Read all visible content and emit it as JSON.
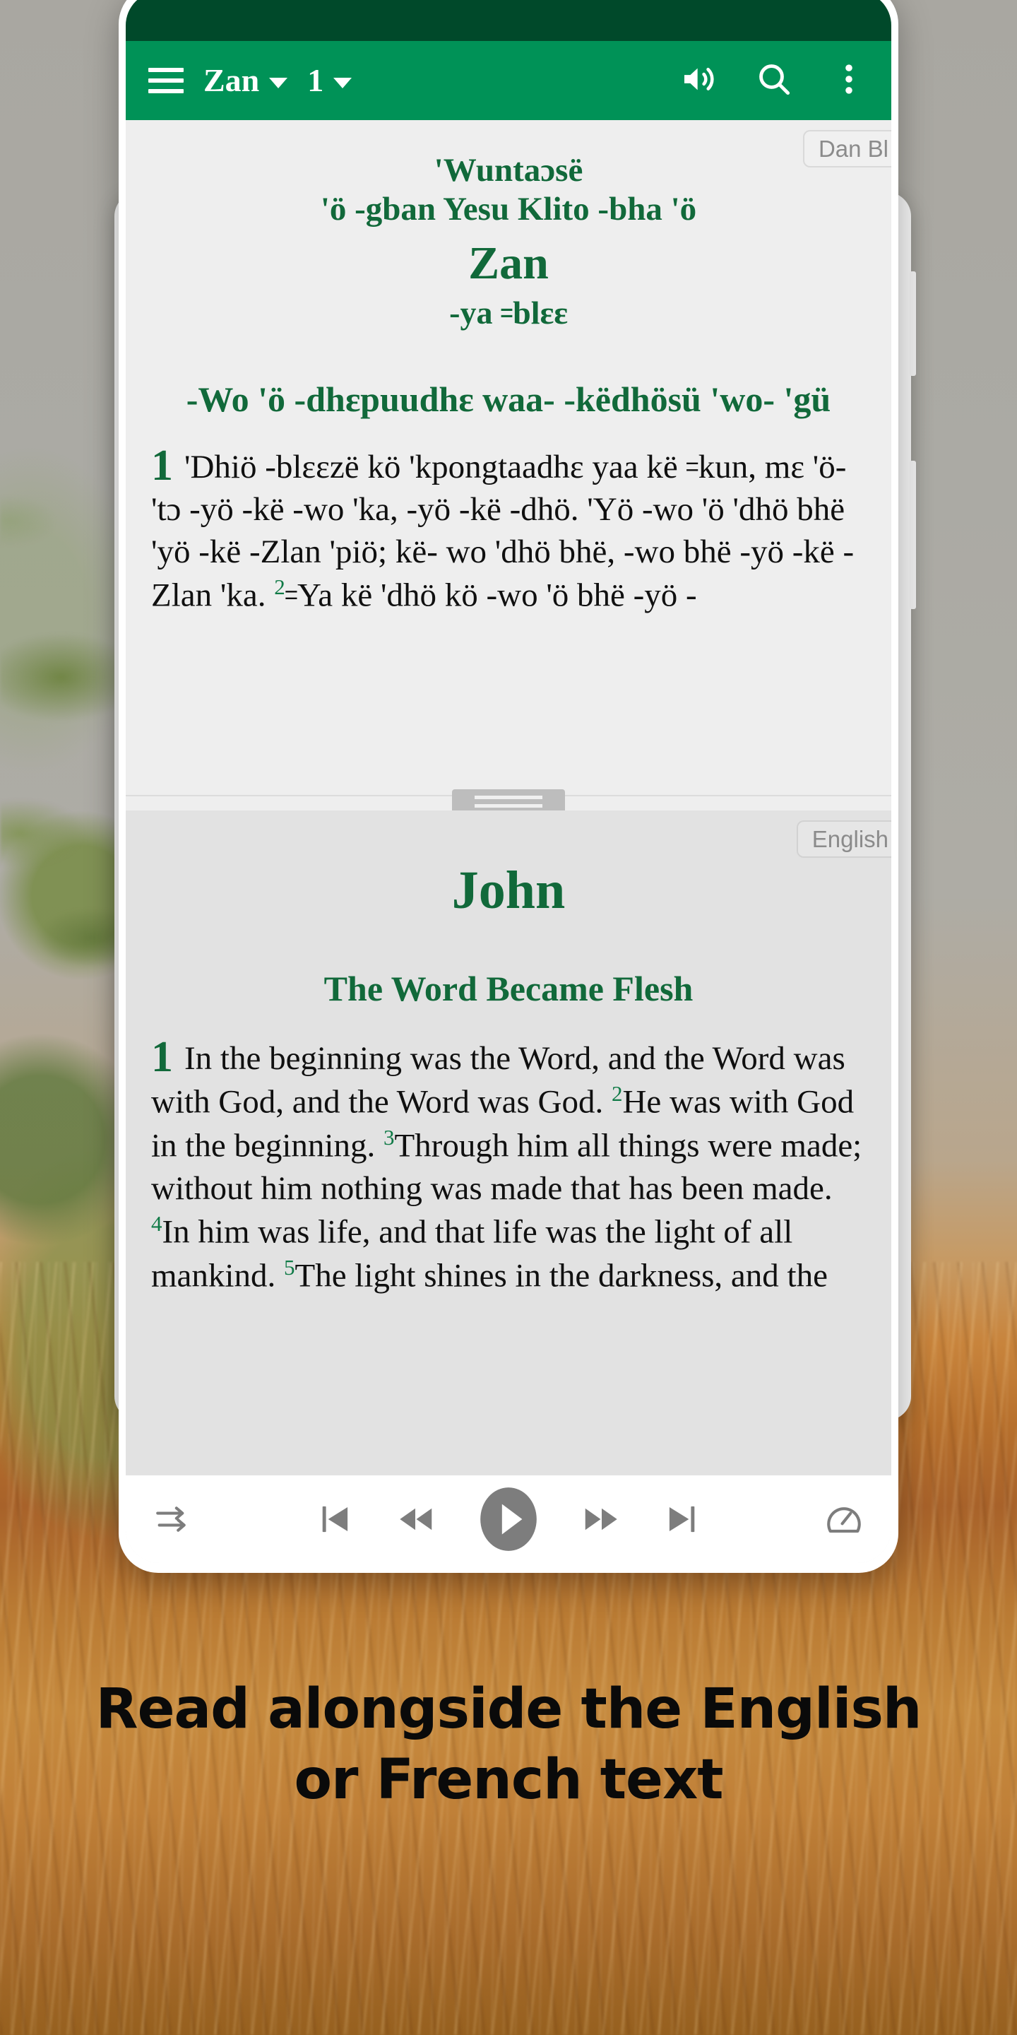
{
  "appbar": {
    "menu_icon": "hamburger-menu-icon",
    "book_label": "Zan",
    "chapter_label": "1",
    "audio_icon": "speaker-volume-icon",
    "search_icon": "search-icon",
    "overflow_icon": "more-vertical-icon"
  },
  "top_pane": {
    "language_badge": "Dan Bl",
    "heading_line1": "'Wuntaɔsë",
    "heading_line2": "'ö -gban Yesu Klito -bha 'ö",
    "book_title": "Zan",
    "book_subtitle": "-ya ꞊blɛɛ",
    "section_heading": "-Wo 'ö -dhɛpuudhɛ waa- -këdhösü 'wo- 'gü",
    "verse1_number": "1",
    "verse1_text": "'Dhiö -blɛɛzë kö 'kpongtaadhɛ yaa kë ꞊kun, mɛ 'ö- 'tɔ -yö -kë -wo 'ka, -yö -kë -dhö. 'Yö -wo 'ö 'dhö bhë 'yö -kë -Zlan 'piö; kë- wo 'dhö bhë, -wo bhë -yö -kë -Zlan 'ka. ",
    "verse2_number": "2",
    "verse2_text": "꞊Ya kë 'dhö kö -wo 'ö bhë -yö -"
  },
  "bottom_pane": {
    "language_badge": "English",
    "book_title": "John",
    "section_heading": "The Word Became Flesh",
    "verse1_number": "1",
    "verse1_text": "In the beginning was the Word, and the Word was with God, and the Word was God. ",
    "verse2_number": "2",
    "verse2_text": "He was with God in the beginning. ",
    "verse3_number": "3",
    "verse3_text": "Through him all things were made; without him nothing was made that has been made. ",
    "verse4_number": "4",
    "verse4_text": "In him was life, and that life was the light of all mankind. ",
    "verse5_number": "5",
    "verse5_text": "The light shines in the darkness, and the"
  },
  "player": {
    "sync_icon": "sync-arrows-icon",
    "previous_icon": "skip-previous-icon",
    "rewind_icon": "rewind-icon",
    "play_icon": "play-icon",
    "forward_icon": "fast-forward-icon",
    "next_icon": "skip-next-icon",
    "speed_icon": "playback-speed-gauge-icon"
  },
  "caption": {
    "text": "Read alongside the English or French text"
  },
  "colors": {
    "status_bar": "#00492a",
    "app_bar": "#009257",
    "heading_green": "#11693a",
    "verse_number_green": "#0f7a46",
    "pane_top_bg": "#eeeeee",
    "pane_bottom_bg": "#e2e2e2"
  }
}
